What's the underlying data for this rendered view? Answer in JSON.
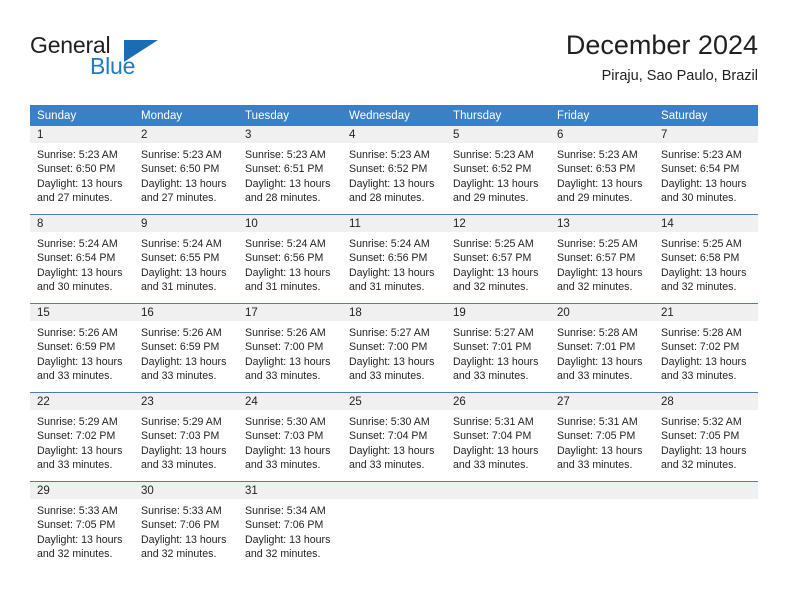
{
  "brand": {
    "name_top": "General",
    "name_bottom": "Blue",
    "logo_icon": "blue-triangle-logo",
    "accent_color": "#1b6cb5"
  },
  "header": {
    "title": "December 2024",
    "location": "Piraju, Sao Paulo, Brazil"
  },
  "calendar": {
    "header_color": "#3b7fc4",
    "daynum_band_color": "#f0f0f0",
    "weekday_headers": [
      "Sunday",
      "Monday",
      "Tuesday",
      "Wednesday",
      "Thursday",
      "Friday",
      "Saturday"
    ],
    "weeks": [
      [
        {
          "day": "1",
          "sunrise": "Sunrise: 5:23 AM",
          "sunset": "Sunset: 6:50 PM",
          "daylight_line1": "Daylight: 13 hours",
          "daylight_line2": "and 27 minutes."
        },
        {
          "day": "2",
          "sunrise": "Sunrise: 5:23 AM",
          "sunset": "Sunset: 6:50 PM",
          "daylight_line1": "Daylight: 13 hours",
          "daylight_line2": "and 27 minutes."
        },
        {
          "day": "3",
          "sunrise": "Sunrise: 5:23 AM",
          "sunset": "Sunset: 6:51 PM",
          "daylight_line1": "Daylight: 13 hours",
          "daylight_line2": "and 28 minutes."
        },
        {
          "day": "4",
          "sunrise": "Sunrise: 5:23 AM",
          "sunset": "Sunset: 6:52 PM",
          "daylight_line1": "Daylight: 13 hours",
          "daylight_line2": "and 28 minutes."
        },
        {
          "day": "5",
          "sunrise": "Sunrise: 5:23 AM",
          "sunset": "Sunset: 6:52 PM",
          "daylight_line1": "Daylight: 13 hours",
          "daylight_line2": "and 29 minutes."
        },
        {
          "day": "6",
          "sunrise": "Sunrise: 5:23 AM",
          "sunset": "Sunset: 6:53 PM",
          "daylight_line1": "Daylight: 13 hours",
          "daylight_line2": "and 29 minutes."
        },
        {
          "day": "7",
          "sunrise": "Sunrise: 5:23 AM",
          "sunset": "Sunset: 6:54 PM",
          "daylight_line1": "Daylight: 13 hours",
          "daylight_line2": "and 30 minutes."
        }
      ],
      [
        {
          "day": "8",
          "sunrise": "Sunrise: 5:24 AM",
          "sunset": "Sunset: 6:54 PM",
          "daylight_line1": "Daylight: 13 hours",
          "daylight_line2": "and 30 minutes."
        },
        {
          "day": "9",
          "sunrise": "Sunrise: 5:24 AM",
          "sunset": "Sunset: 6:55 PM",
          "daylight_line1": "Daylight: 13 hours",
          "daylight_line2": "and 31 minutes."
        },
        {
          "day": "10",
          "sunrise": "Sunrise: 5:24 AM",
          "sunset": "Sunset: 6:56 PM",
          "daylight_line1": "Daylight: 13 hours",
          "daylight_line2": "and 31 minutes."
        },
        {
          "day": "11",
          "sunrise": "Sunrise: 5:24 AM",
          "sunset": "Sunset: 6:56 PM",
          "daylight_line1": "Daylight: 13 hours",
          "daylight_line2": "and 31 minutes."
        },
        {
          "day": "12",
          "sunrise": "Sunrise: 5:25 AM",
          "sunset": "Sunset: 6:57 PM",
          "daylight_line1": "Daylight: 13 hours",
          "daylight_line2": "and 32 minutes."
        },
        {
          "day": "13",
          "sunrise": "Sunrise: 5:25 AM",
          "sunset": "Sunset: 6:57 PM",
          "daylight_line1": "Daylight: 13 hours",
          "daylight_line2": "and 32 minutes."
        },
        {
          "day": "14",
          "sunrise": "Sunrise: 5:25 AM",
          "sunset": "Sunset: 6:58 PM",
          "daylight_line1": "Daylight: 13 hours",
          "daylight_line2": "and 32 minutes."
        }
      ],
      [
        {
          "day": "15",
          "sunrise": "Sunrise: 5:26 AM",
          "sunset": "Sunset: 6:59 PM",
          "daylight_line1": "Daylight: 13 hours",
          "daylight_line2": "and 33 minutes."
        },
        {
          "day": "16",
          "sunrise": "Sunrise: 5:26 AM",
          "sunset": "Sunset: 6:59 PM",
          "daylight_line1": "Daylight: 13 hours",
          "daylight_line2": "and 33 minutes."
        },
        {
          "day": "17",
          "sunrise": "Sunrise: 5:26 AM",
          "sunset": "Sunset: 7:00 PM",
          "daylight_line1": "Daylight: 13 hours",
          "daylight_line2": "and 33 minutes."
        },
        {
          "day": "18",
          "sunrise": "Sunrise: 5:27 AM",
          "sunset": "Sunset: 7:00 PM",
          "daylight_line1": "Daylight: 13 hours",
          "daylight_line2": "and 33 minutes."
        },
        {
          "day": "19",
          "sunrise": "Sunrise: 5:27 AM",
          "sunset": "Sunset: 7:01 PM",
          "daylight_line1": "Daylight: 13 hours",
          "daylight_line2": "and 33 minutes."
        },
        {
          "day": "20",
          "sunrise": "Sunrise: 5:28 AM",
          "sunset": "Sunset: 7:01 PM",
          "daylight_line1": "Daylight: 13 hours",
          "daylight_line2": "and 33 minutes."
        },
        {
          "day": "21",
          "sunrise": "Sunrise: 5:28 AM",
          "sunset": "Sunset: 7:02 PM",
          "daylight_line1": "Daylight: 13 hours",
          "daylight_line2": "and 33 minutes."
        }
      ],
      [
        {
          "day": "22",
          "sunrise": "Sunrise: 5:29 AM",
          "sunset": "Sunset: 7:02 PM",
          "daylight_line1": "Daylight: 13 hours",
          "daylight_line2": "and 33 minutes."
        },
        {
          "day": "23",
          "sunrise": "Sunrise: 5:29 AM",
          "sunset": "Sunset: 7:03 PM",
          "daylight_line1": "Daylight: 13 hours",
          "daylight_line2": "and 33 minutes."
        },
        {
          "day": "24",
          "sunrise": "Sunrise: 5:30 AM",
          "sunset": "Sunset: 7:03 PM",
          "daylight_line1": "Daylight: 13 hours",
          "daylight_line2": "and 33 minutes."
        },
        {
          "day": "25",
          "sunrise": "Sunrise: 5:30 AM",
          "sunset": "Sunset: 7:04 PM",
          "daylight_line1": "Daylight: 13 hours",
          "daylight_line2": "and 33 minutes."
        },
        {
          "day": "26",
          "sunrise": "Sunrise: 5:31 AM",
          "sunset": "Sunset: 7:04 PM",
          "daylight_line1": "Daylight: 13 hours",
          "daylight_line2": "and 33 minutes."
        },
        {
          "day": "27",
          "sunrise": "Sunrise: 5:31 AM",
          "sunset": "Sunset: 7:05 PM",
          "daylight_line1": "Daylight: 13 hours",
          "daylight_line2": "and 33 minutes."
        },
        {
          "day": "28",
          "sunrise": "Sunrise: 5:32 AM",
          "sunset": "Sunset: 7:05 PM",
          "daylight_line1": "Daylight: 13 hours",
          "daylight_line2": "and 32 minutes."
        }
      ],
      [
        {
          "day": "29",
          "sunrise": "Sunrise: 5:33 AM",
          "sunset": "Sunset: 7:05 PM",
          "daylight_line1": "Daylight: 13 hours",
          "daylight_line2": "and 32 minutes."
        },
        {
          "day": "30",
          "sunrise": "Sunrise: 5:33 AM",
          "sunset": "Sunset: 7:06 PM",
          "daylight_line1": "Daylight: 13 hours",
          "daylight_line2": "and 32 minutes."
        },
        {
          "day": "31",
          "sunrise": "Sunrise: 5:34 AM",
          "sunset": "Sunset: 7:06 PM",
          "daylight_line1": "Daylight: 13 hours",
          "daylight_line2": "and 32 minutes."
        },
        {
          "day": "",
          "sunrise": "",
          "sunset": "",
          "daylight_line1": "",
          "daylight_line2": ""
        },
        {
          "day": "",
          "sunrise": "",
          "sunset": "",
          "daylight_line1": "",
          "daylight_line2": ""
        },
        {
          "day": "",
          "sunrise": "",
          "sunset": "",
          "daylight_line1": "",
          "daylight_line2": ""
        },
        {
          "day": "",
          "sunrise": "",
          "sunset": "",
          "daylight_line1": "",
          "daylight_line2": ""
        }
      ]
    ]
  }
}
